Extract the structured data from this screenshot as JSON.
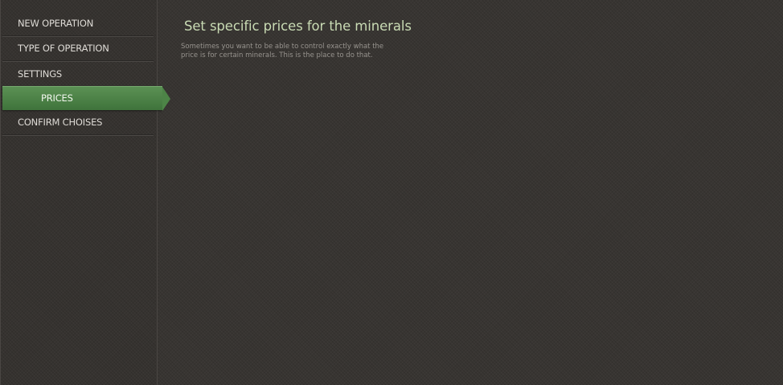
{
  "sidebar": {
    "items": [
      {
        "label": "NEW OPERATION"
      },
      {
        "label": "TYPE OF OPERATION"
      },
      {
        "label": "SETTINGS"
      },
      {
        "label": "PRICES"
      },
      {
        "label": "CONFIRM CHOISES"
      }
    ],
    "active_item": "PRICES"
  },
  "main": {
    "title": "Set specific prices for the minerals",
    "description": "Sometimes you want to be able to control exactly what the price is for certain minerals. This is the place to do that."
  },
  "colors": {
    "background": "#383532",
    "accent_green": "#4d8447",
    "title_text": "#c9dbb4",
    "description_text": "#97938e"
  }
}
